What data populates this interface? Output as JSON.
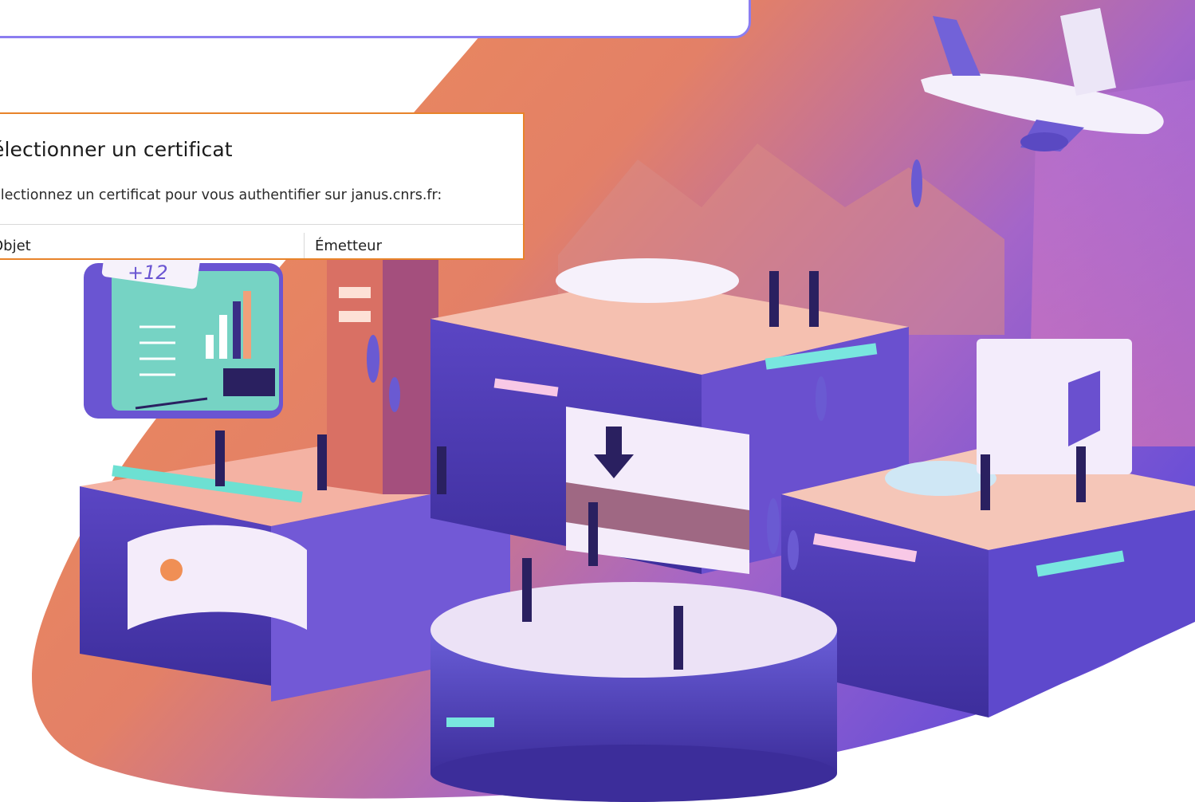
{
  "dialog": {
    "title": "électionner un certificat",
    "subtitle": "électionnez un certificat pour vous authentifier sur janus.cnrs.fr:",
    "columns": [
      "Objet",
      "Émetteur"
    ]
  },
  "illustration": {
    "sticker_text": "+12"
  },
  "colors": {
    "dialog_border": "#e8832a",
    "card_border": "#8b7df0",
    "blob_orange": "#ef8f55",
    "blob_purple": "#7d5be0"
  }
}
